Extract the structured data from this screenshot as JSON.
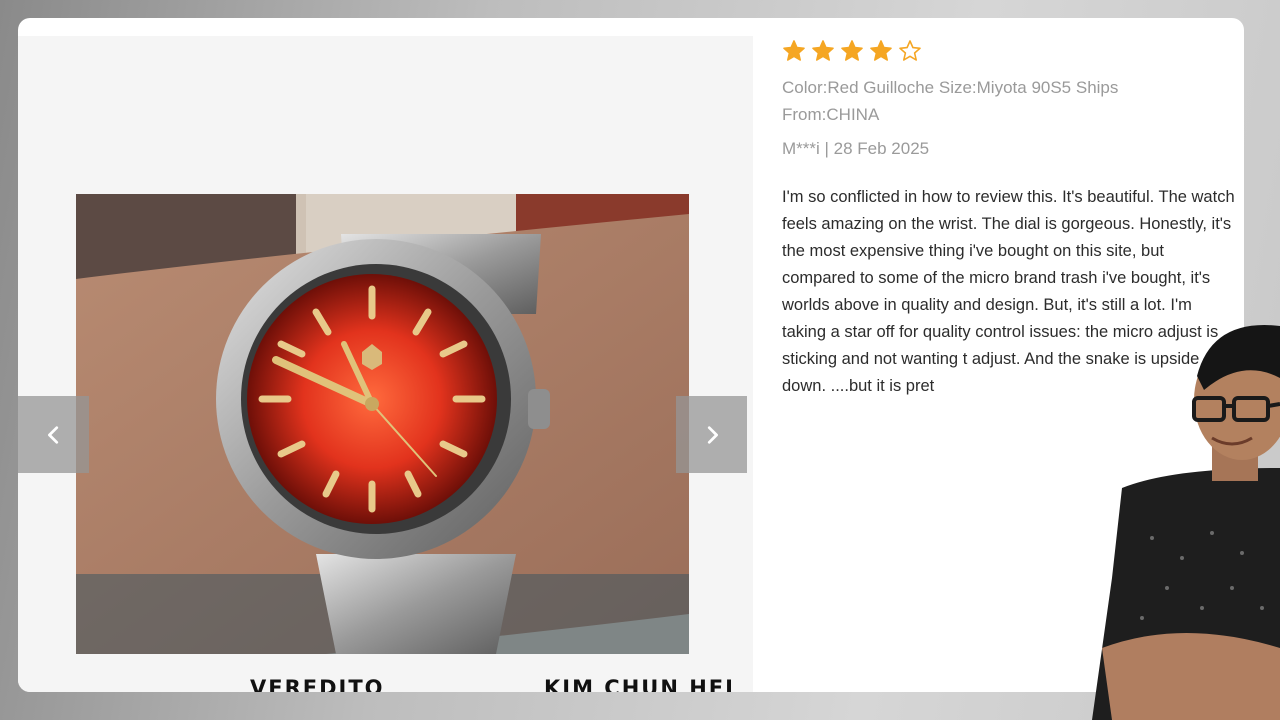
{
  "review": {
    "rating": 4,
    "max_rating": 5,
    "star_color": "#f5a623",
    "variant": "Color:Red Guilloche Size:Miyota 90S5 Ships From:CHINA",
    "author_date": "M***i | 28 Feb 2025",
    "text": "I'm so conflicted in how to review this. It's beautiful. The watch feels amazing on the wrist. The dial is gorgeous. Honestly, it's the most expensive thing i've bought on this site, but compared to some of the micro brand trash i've bought, it's worlds above in quality and design. But, it's still a lot. I'm taking a star off for quality control issues: the micro adjust is sticking and not wanting t adjust. And the snake is upside down. ....but it is pret"
  },
  "gallery": {
    "prev_icon": "chevron-left-icon",
    "next_icon": "chevron-right-icon"
  },
  "captions": {
    "left": "VEREDITO",
    "right": "KIM CHUN HEI"
  }
}
